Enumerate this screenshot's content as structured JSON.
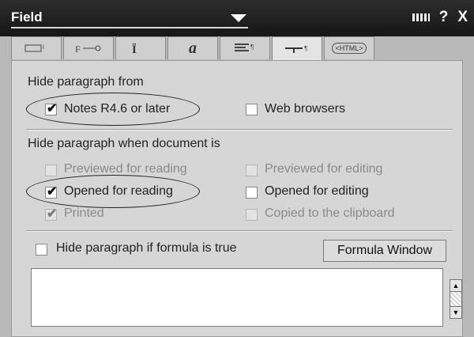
{
  "window": {
    "title": "Field",
    "help_label": "?",
    "close_label": "X"
  },
  "tabs": [
    {
      "icon": "field-info-icon"
    },
    {
      "icon": "field-format-icon"
    },
    {
      "icon": "font-icon",
      "label": "a"
    },
    {
      "icon": "alignment-icon"
    },
    {
      "icon": "hide-when-icon"
    },
    {
      "icon": "html-icon",
      "label": "<HTML>"
    }
  ],
  "sections": {
    "hide_from_label": "Hide paragraph from",
    "hide_when_label": "Hide paragraph when document is"
  },
  "options": {
    "notes": {
      "label": "Notes R4.6 or later",
      "checked": true
    },
    "web": {
      "label": "Web browsers",
      "checked": false
    },
    "prev_read": {
      "label": "Previewed for reading",
      "checked": false
    },
    "prev_edit": {
      "label": "Previewed for editing",
      "checked": false
    },
    "open_read": {
      "label": "Opened for reading",
      "checked": true
    },
    "open_edit": {
      "label": "Opened for editing",
      "checked": false
    },
    "printed": {
      "label": "Printed",
      "checked": true
    },
    "copied": {
      "label": "Copied to the clipboard",
      "checked": false
    }
  },
  "formula": {
    "checkbox_label": "Hide paragraph if formula is true",
    "button_label": "Formula Window",
    "text": ""
  },
  "tick_glyph": "✔"
}
